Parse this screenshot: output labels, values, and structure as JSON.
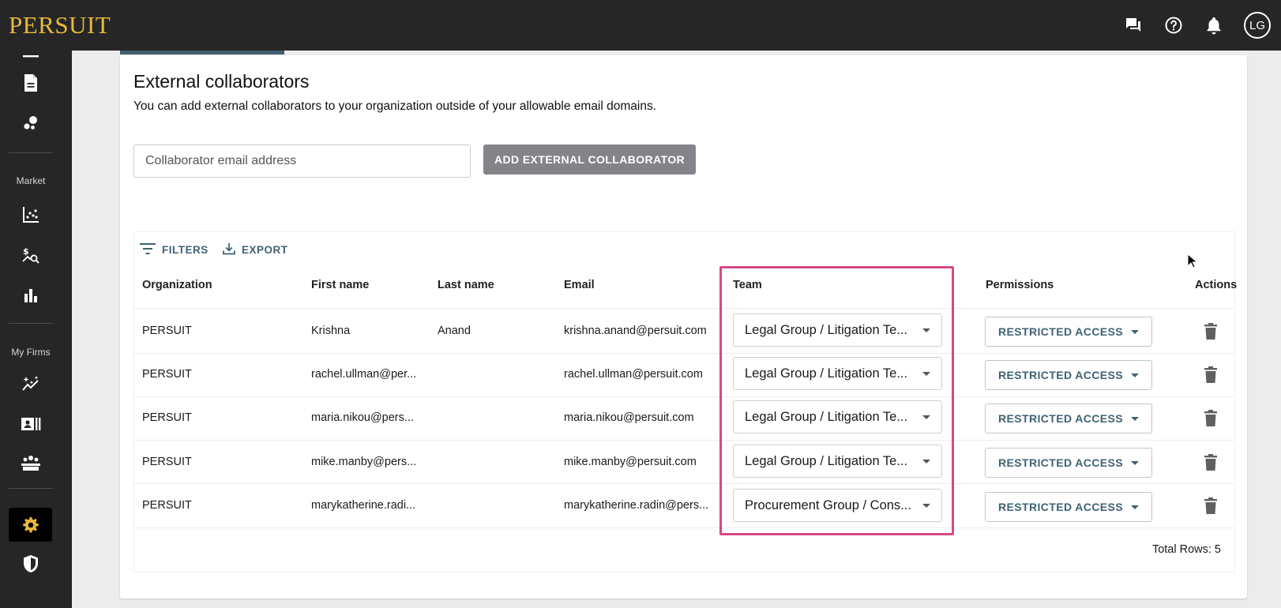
{
  "topbar": {
    "logo": "PERSUIT",
    "icons": [
      "chat-icon",
      "help-icon",
      "notifications-icon"
    ],
    "avatar_initials": "LG"
  },
  "sidebar": {
    "section_market": "Market",
    "section_my_firms": "My Firms"
  },
  "page": {
    "title": "External collaborators",
    "subtitle": "You can add external collaborators to your organization outside of your allowable email domains.",
    "email_placeholder": "Collaborator email address",
    "add_button": "ADD EXTERNAL COLLABORATOR"
  },
  "grid": {
    "filters_label": "FILTERS",
    "export_label": "EXPORT",
    "columns": [
      "Organization",
      "First name",
      "Last name",
      "Email",
      "Team",
      "Permissions",
      "Actions"
    ],
    "rows": [
      {
        "organization": "PERSUIT",
        "first_name": "Krishna",
        "last_name": "Anand",
        "email": "krishna.anand@persuit.com",
        "team": "Legal Group / Litigation Te...",
        "permission": "RESTRICTED ACCESS"
      },
      {
        "organization": "PERSUIT",
        "first_name": "rachel.ullman@per...",
        "last_name": "",
        "email": "rachel.ullman@persuit.com",
        "team": "Legal Group / Litigation Te...",
        "permission": "RESTRICTED ACCESS"
      },
      {
        "organization": "PERSUIT",
        "first_name": "maria.nikou@pers...",
        "last_name": "",
        "email": "maria.nikou@persuit.com",
        "team": "Legal Group / Litigation Te...",
        "permission": "RESTRICTED ACCESS"
      },
      {
        "organization": "PERSUIT",
        "first_name": "mike.manby@pers...",
        "last_name": "",
        "email": "mike.manby@persuit.com",
        "team": "Legal Group / Litigation Te...",
        "permission": "RESTRICTED ACCESS"
      },
      {
        "organization": "PERSUIT",
        "first_name": "marykatherine.radi...",
        "last_name": "",
        "email": "marykatherine.radin@pers...",
        "team": "Procurement Group / Cons...",
        "permission": "RESTRICTED ACCESS"
      }
    ],
    "total_rows": "Total Rows: 5"
  },
  "colors": {
    "topbar_bg": "#262626",
    "logo": "#e8b93a",
    "accent": "#3f6274",
    "highlight": "#d94885",
    "button_gray": "#83848a"
  }
}
